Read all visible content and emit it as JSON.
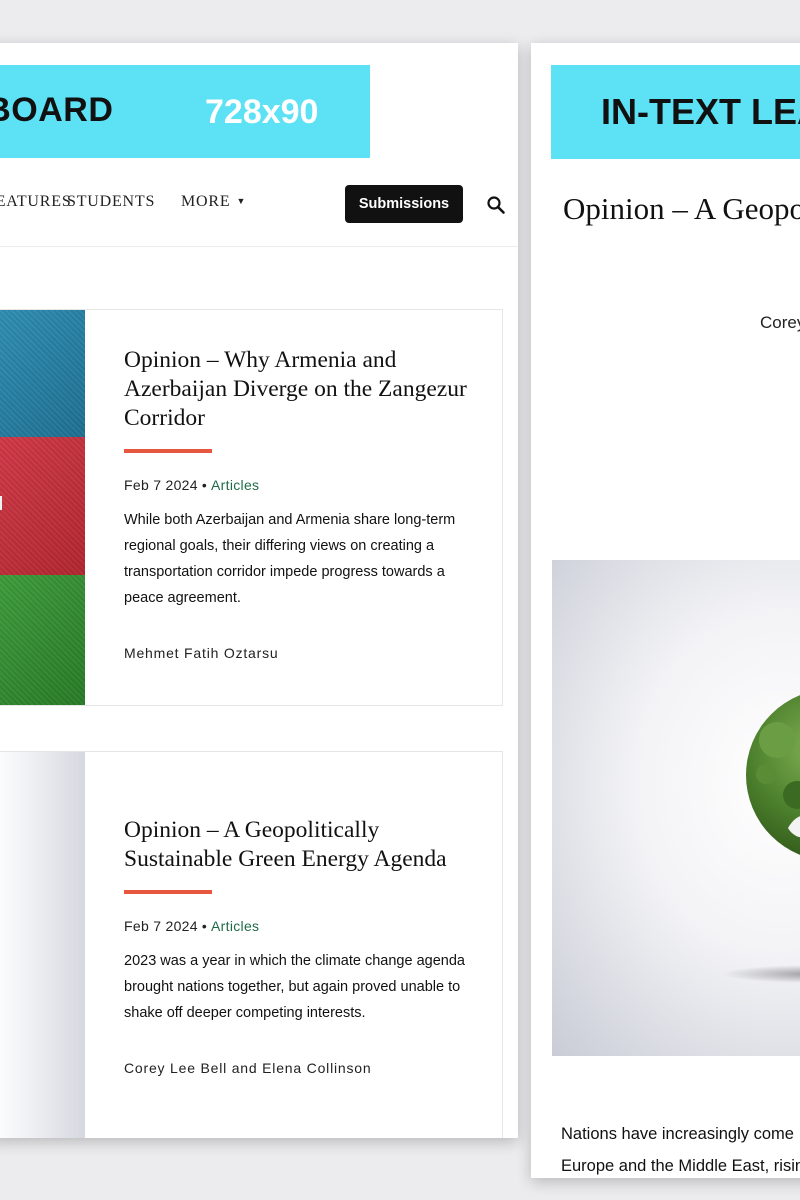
{
  "left_panel": {
    "ad_banner": {
      "label": "ERBOARD",
      "size": "728x90"
    },
    "nav": {
      "items": [
        "FEATURES",
        "STUDENTS",
        "MORE"
      ],
      "submissions_label": "Submissions"
    },
    "articles": [
      {
        "title": "Opinion – Why Armenia and Azerbaijan Diverge on the Zangezur Corridor",
        "date": "Feb 7 2024",
        "separator": "•",
        "category": "Articles",
        "excerpt": "While both Azerbaijan and Armenia share long-term regional goals, their differing views on creating a transportation corridor impede progress towards a peace agreement.",
        "author": "Mehmet Fatih Oztarsu",
        "thumbnail": "azerbaijan-flag"
      },
      {
        "title": "Opinion – A Geopolitically Sustainable Green Energy Agenda",
        "date": "Feb 7 2024",
        "separator": "•",
        "category": "Articles",
        "excerpt": "2023 was a year in which the climate change agenda brought nations together, but again proved unable to shake off deeper competing interests.",
        "author": "Corey Lee Bell and Elena Collinson",
        "thumbnail": "tree-globe"
      }
    ]
  },
  "right_panel": {
    "ad_banner": {
      "label": "IN-TEXT LEAD"
    },
    "title": "Opinion – A Geopolitically Sustainable Green Energy Agenda",
    "author": "Corey Lee Bell and Elena Collinson",
    "image": "tree-globe",
    "body_lines": [
      "Nations have increasingly come",
      "Europe and the Middle East, rising"
    ]
  },
  "colors": {
    "ad_banner": "#5ce1f5",
    "accent_rule": "#e5573f",
    "category_link": "#1f6b48",
    "submissions_button": "#111111"
  }
}
